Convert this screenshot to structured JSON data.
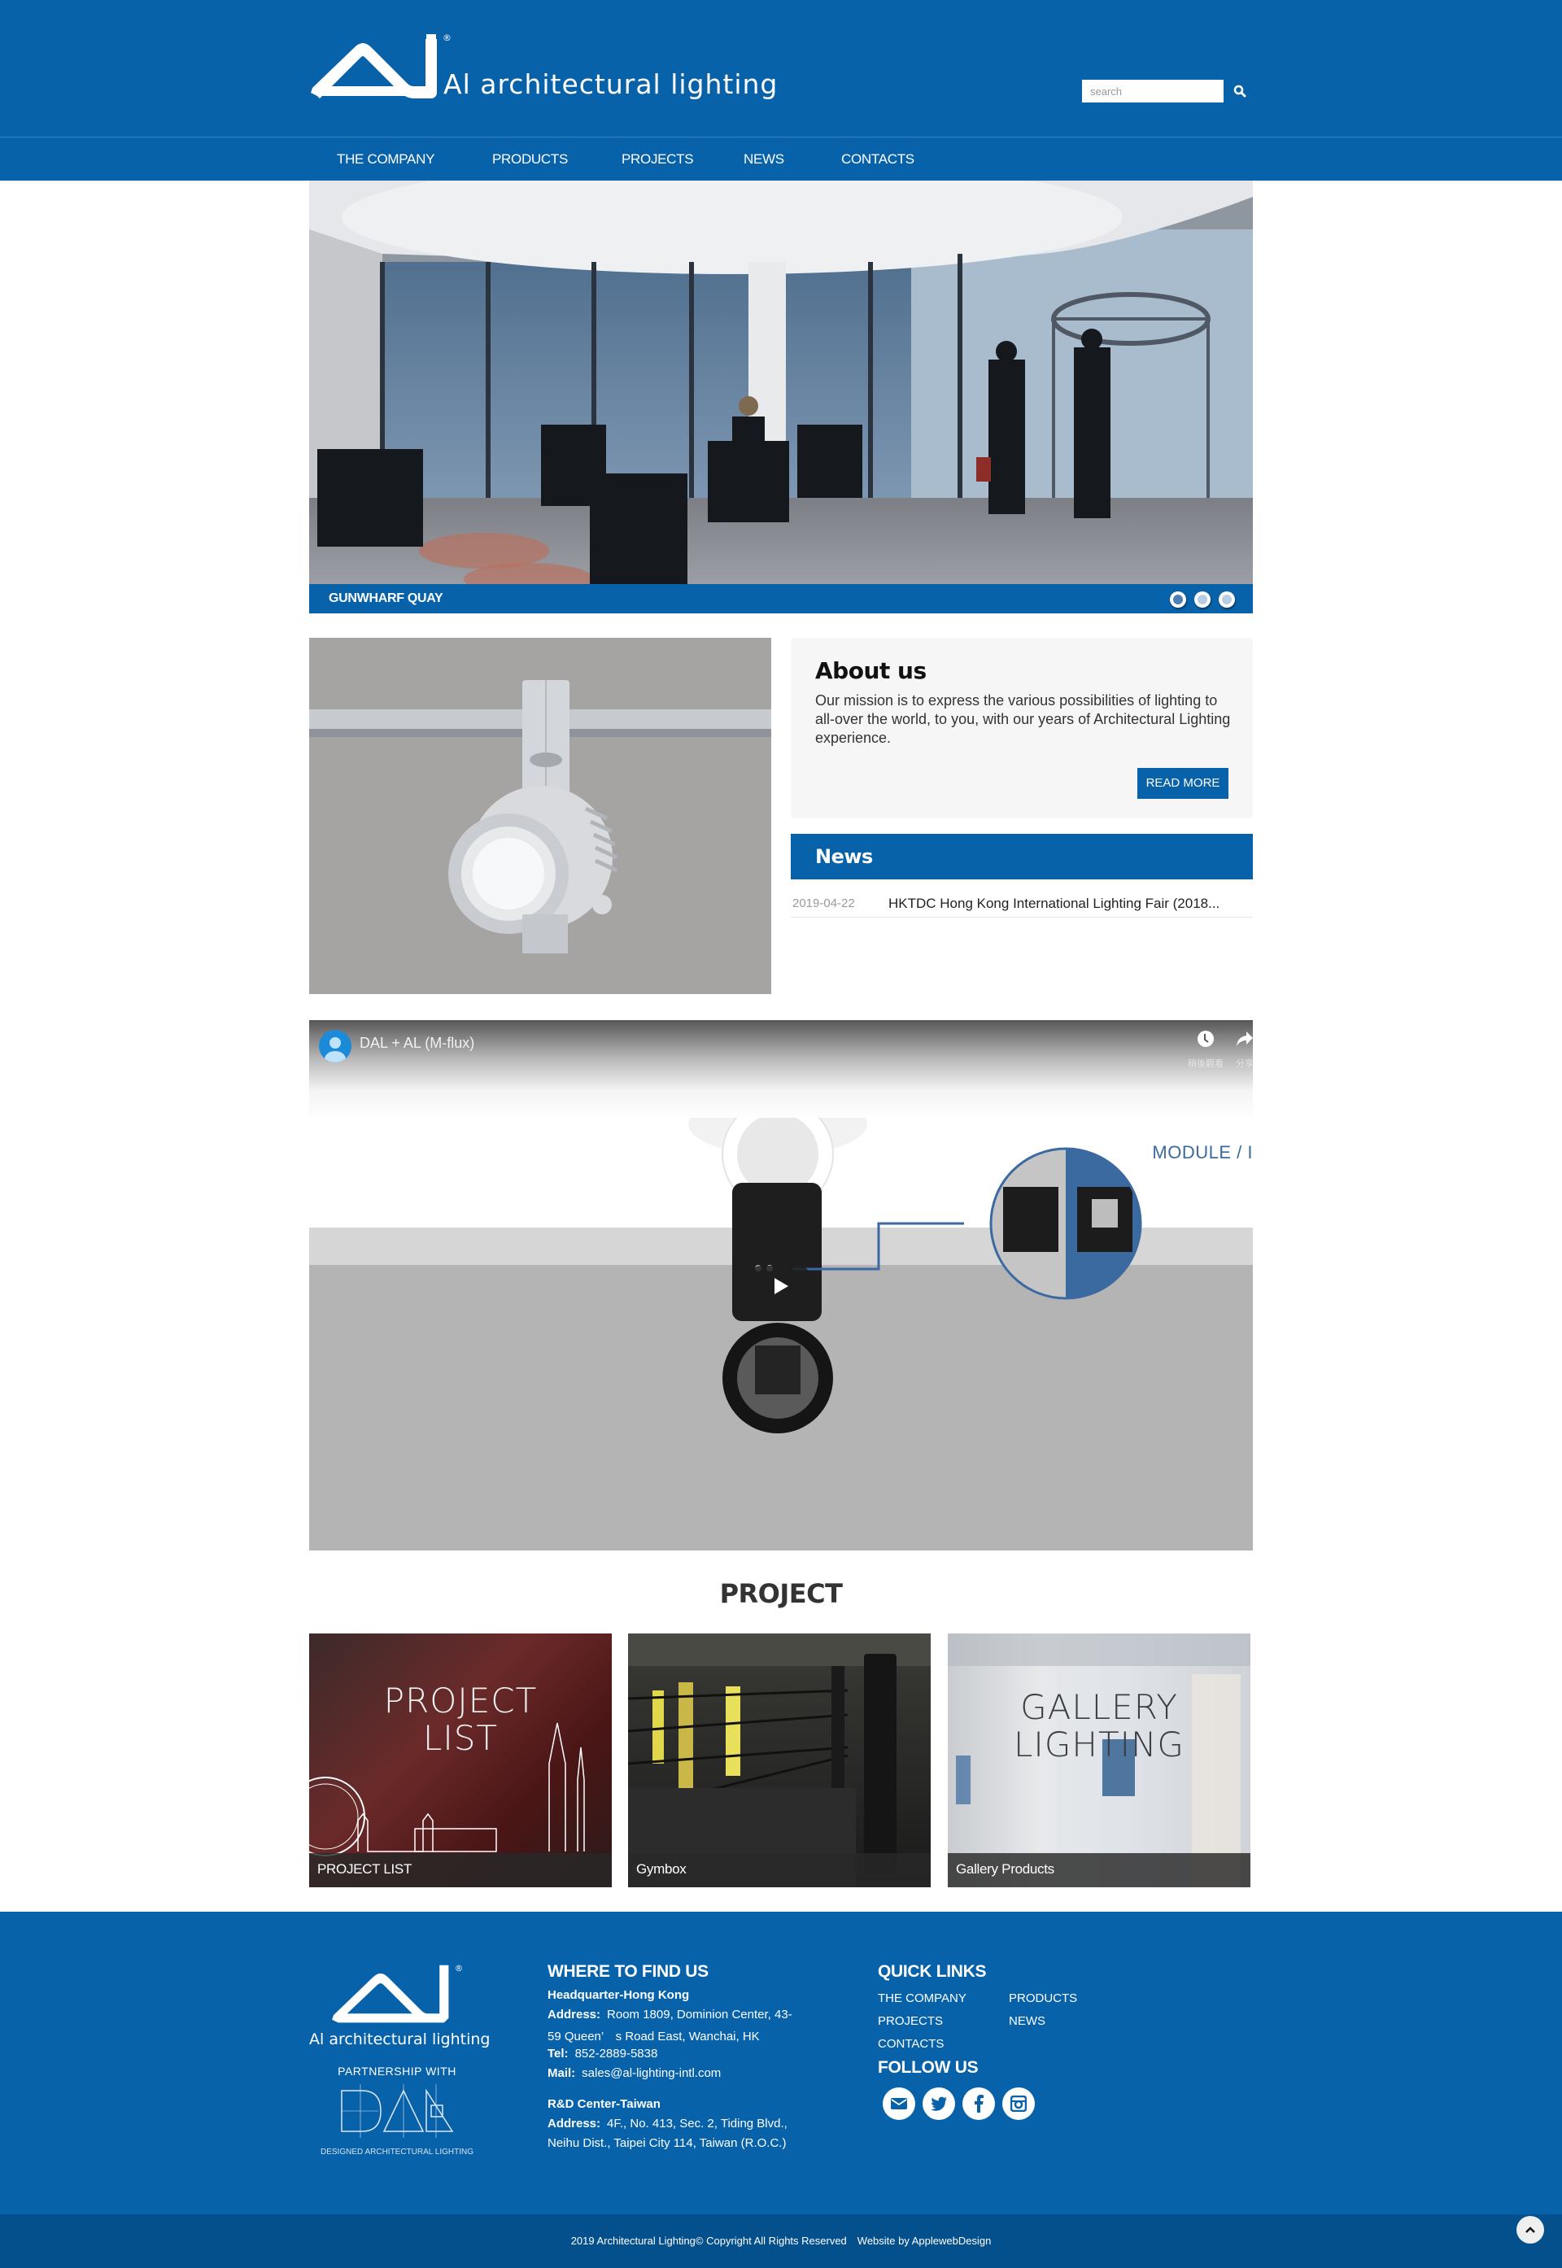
{
  "header": {
    "brand_name": "Al architectural lighting",
    "registered_mark": "®",
    "search": {
      "placeholder": "search",
      "value": ""
    },
    "search_icon": "magnifier-icon"
  },
  "nav": {
    "items": [
      {
        "label": "THE COMPANY"
      },
      {
        "label": "PRODUCTS"
      },
      {
        "label": "PROJECTS"
      },
      {
        "label": "NEWS"
      },
      {
        "label": "CONTACTS"
      }
    ]
  },
  "hero": {
    "caption": "GUNWHARF QUAY",
    "slide_count": 3,
    "active_slide": 1
  },
  "about": {
    "title": "About us",
    "text": "Our mission is to express the various possibilities of lighting to all-over the world, to you, with our years of Architectural Lighting experience.",
    "button_label": "READ MORE"
  },
  "news": {
    "title": "News",
    "items": [
      {
        "date": "2019-04-22",
        "headline": "HKTDC Hong Kong International Lighting Fair (2018..."
      }
    ]
  },
  "video": {
    "title": "DAL + AL (M-flux)",
    "watch_later_label": "稍後觀看",
    "share_label": "分享",
    "overlay_text": "MODULE / I"
  },
  "project": {
    "heading": "PROJECT",
    "cards": [
      {
        "overlay": [
          "PROJECT",
          "LIST"
        ],
        "label": "PROJECT LIST"
      },
      {
        "overlay": [],
        "label": "Gymbox"
      },
      {
        "overlay": [
          "GALLERY",
          "LIGHTING"
        ],
        "label": "Gallery Products"
      }
    ]
  },
  "footer": {
    "brand_name": "Al architectural lighting",
    "partnership_label": "PARTNERSHIP WITH",
    "partner_tagline": "DESIGNED ARCHITECTURAL LIGHTING",
    "where": {
      "title": "WHERE TO FIND US",
      "hq_title": "Headquarter-Hong Kong",
      "hq_address_label": "Address:",
      "hq_address_line1": "Room 1809, Dominion Center, 43-",
      "hq_address_line2": "59 Queen’　s Road East, Wanchai, HK",
      "tel_label": "Tel:",
      "tel": "852-2889-5838",
      "mail_label": "Mail:",
      "mail": "sales@al-lighting-intl.com",
      "rd_title": "R&D Center-Taiwan",
      "rd_address_label": "Address:",
      "rd_address_line1": "4F., No. 413, Sec. 2, Tiding Blvd.,",
      "rd_address_line2": "Neihu Dist., Taipei City 114, Taiwan (R.O.C.)"
    },
    "quick_links": {
      "title": "QUICK LINKS",
      "items": [
        {
          "label": "THE COMPANY"
        },
        {
          "label": "PRODUCTS"
        },
        {
          "label": "PROJECTS"
        },
        {
          "label": "NEWS"
        },
        {
          "label": "CONTACTS"
        }
      ]
    },
    "follow": {
      "title": "FOLLOW US",
      "icons": [
        "envelope-icon",
        "twitter-icon",
        "facebook-icon",
        "instagram-icon"
      ]
    },
    "copyright": "2019 Architectural Lighting© Copyright All Rights Reserved　Website by ApplewebDesign"
  },
  "colors": {
    "brand_blue": "#0762aa",
    "bottom_bar": "#04508d",
    "about_bg": "#f6f6f6"
  }
}
